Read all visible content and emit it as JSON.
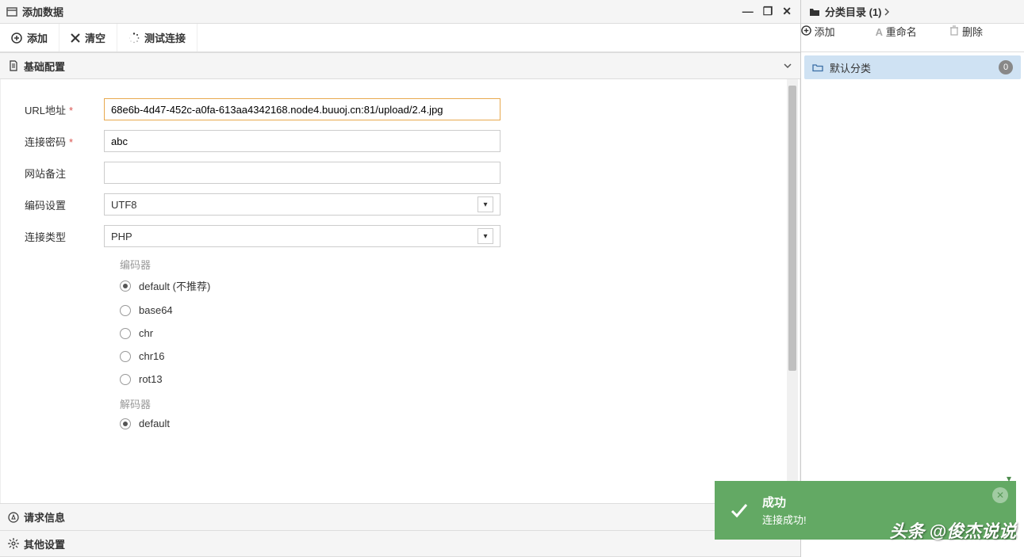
{
  "window": {
    "title": "添加数据",
    "minimize": "—",
    "maximize": "❐",
    "close": "✕"
  },
  "toolbar": {
    "add": "添加",
    "clear": "清空",
    "test": "测试连接"
  },
  "sections": {
    "basic": "基础配置",
    "request": "请求信息",
    "other": "其他设置"
  },
  "form": {
    "url_label": "URL地址",
    "url_value": "68e6b-4d47-452c-a0fa-613aa4342168.node4.buuoj.cn:81/upload/2.4.jpg",
    "pwd_label": "连接密码",
    "pwd_value": "abc",
    "note_label": "网站备注",
    "note_value": "",
    "enc_label": "编码设置",
    "enc_value": "UTF8",
    "type_label": "连接类型",
    "type_value": "PHP",
    "encoder_label": "编码器",
    "decoder_label": "解码器",
    "encoders": [
      {
        "label": "default (不推荐)",
        "checked": true
      },
      {
        "label": "base64",
        "checked": false
      },
      {
        "label": "chr",
        "checked": false
      },
      {
        "label": "chr16",
        "checked": false
      },
      {
        "label": "rot13",
        "checked": false
      }
    ],
    "decoders": [
      {
        "label": "default",
        "checked": true
      }
    ]
  },
  "right": {
    "title": "分类目录 (1)",
    "add": "添加",
    "rename": "重命名",
    "delete": "删除",
    "default_cat": "默认分类",
    "badge": "0"
  },
  "toast": {
    "title": "成功",
    "body": "连接成功!"
  },
  "watermark": "头条 @俊杰说说"
}
